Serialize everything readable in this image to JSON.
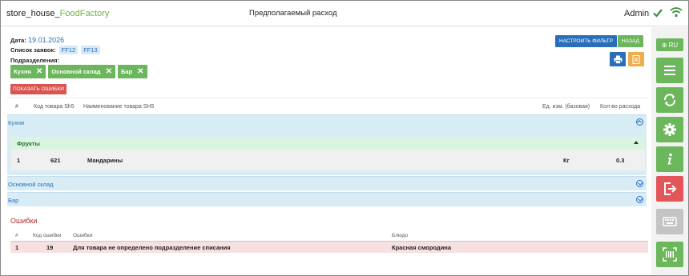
{
  "header": {
    "brand_main": "store_house_",
    "brand_accent": "FoodFactory",
    "title": "Предполагаемый расход",
    "user": "Admin"
  },
  "filters": {
    "date_label": "Дата:",
    "date_value": "19.01.2026",
    "requests_label": "Список заявок:",
    "requests": [
      "FF12",
      "FF13"
    ],
    "divisions_label": "Подразделения:",
    "divisions": [
      "Кухня",
      "Основной склад",
      "Бар"
    ],
    "show_errors_label": "ПОКАЗАТЬ ОШИБКИ"
  },
  "actions": {
    "filter_label": "НАСТРОИТЬ ФИЛЬТР",
    "back_label": "НАЗАД"
  },
  "table": {
    "columns": [
      "#",
      "Код товара Sh5",
      "Наименование товара SH5",
      "Ед. изм. (базовая)",
      "Кол-во расхода"
    ],
    "groups": [
      {
        "name": "Кухня",
        "expanded": true,
        "subgroups": [
          {
            "name": "Фрукты",
            "rows": [
              {
                "num": "1",
                "code": "621",
                "name": "Мандарины",
                "unit": "Кг",
                "qty": "0.3"
              }
            ]
          }
        ]
      },
      {
        "name": "Основной склад",
        "expanded": false
      },
      {
        "name": "Бар",
        "expanded": false
      }
    ]
  },
  "errors": {
    "title": "Ошибки",
    "columns": [
      "#",
      "Код ошибки",
      "Ошибки",
      "Блюдо"
    ],
    "rows": [
      {
        "num": "1",
        "code": "19",
        "message": "Для товара не определено подразделение списания",
        "dish": "Красная смородина"
      }
    ]
  },
  "sidebar": {
    "lang_label": "RU",
    "buttons": [
      "menu-icon",
      "refresh-icon",
      "gear-icon",
      "info-icon",
      "logout-icon",
      "keyboard-icon",
      "barcode-scan-icon"
    ]
  },
  "colors": {
    "accent_green": "#6cb65c",
    "accent_blue": "#2a6ebb",
    "danger": "#d9534f",
    "warning": "#f0ad4e"
  }
}
